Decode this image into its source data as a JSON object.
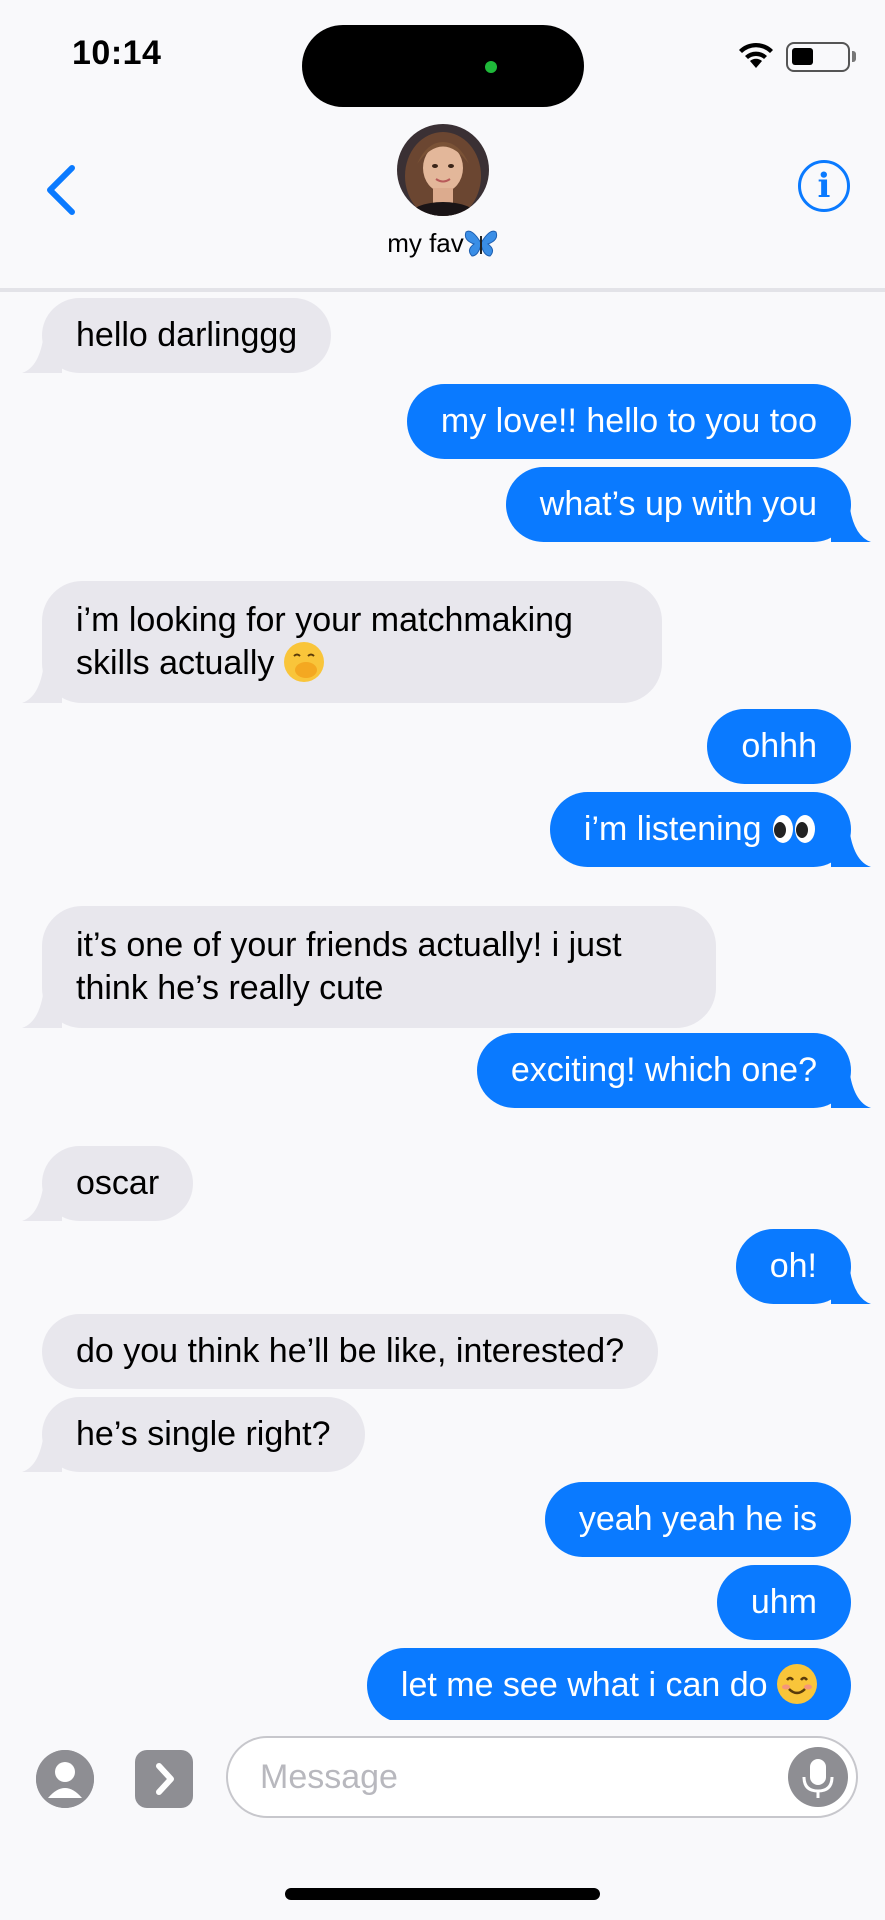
{
  "status_bar": {
    "time": "10:14",
    "battery_level": 0.4
  },
  "header": {
    "contact_name": "my fav",
    "contact_emoji": "butterfly",
    "back_icon": "chevron-left-icon",
    "info_icon": "info-icon",
    "info_glyph": "i"
  },
  "messages": [
    {
      "from": "them",
      "text": "hello darlinggg"
    },
    {
      "from": "me",
      "text": "my love!! hello to you too"
    },
    {
      "from": "me",
      "text": "what’s up with you"
    },
    {
      "from": "them",
      "text": "i’m looking for your matchmaking skills actually",
      "emoji": "hand-over-mouth"
    },
    {
      "from": "me",
      "text": "ohhh"
    },
    {
      "from": "me",
      "text": "i’m listening",
      "emoji": "eyes"
    },
    {
      "from": "them",
      "text": "it’s one of your friends actually! i just think he’s really cute"
    },
    {
      "from": "me",
      "text": "exciting! which one?"
    },
    {
      "from": "them",
      "text": "oscar"
    },
    {
      "from": "me",
      "text": "oh!"
    },
    {
      "from": "them",
      "text": "do you think he’ll be like, interested?"
    },
    {
      "from": "them",
      "text": "he’s single right?"
    },
    {
      "from": "me",
      "text": "yeah yeah he is"
    },
    {
      "from": "me",
      "text": "uhm"
    },
    {
      "from": "me",
      "text": "let me see what i can do",
      "emoji": "smiling-face"
    }
  ],
  "input": {
    "placeholder": "Message"
  },
  "colors": {
    "outgoing": "#0a7aff",
    "incoming": "#e8e7ed",
    "accent": "#0a7aff"
  }
}
